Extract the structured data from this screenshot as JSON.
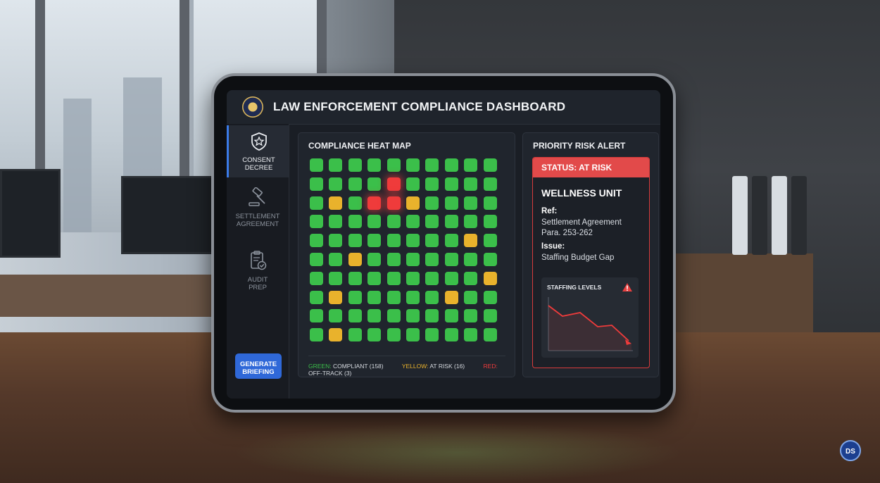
{
  "app": {
    "title": "LAW ENFORCEMENT COMPLIANCE DASHBOARD"
  },
  "sidebar": {
    "items": [
      {
        "label_line1": "CONSENT",
        "label_line2": "DECREE",
        "icon": "shield-star-icon",
        "active": true
      },
      {
        "label_line1": "SETTLEMENT",
        "label_line2": "AGREEMENT",
        "icon": "gavel-icon",
        "active": false
      },
      {
        "label_line1": "AUDIT",
        "label_line2": "PREP",
        "icon": "clipboard-check-icon",
        "active": false
      }
    ],
    "generate_line1": "GENERATE",
    "generate_line2": "BRIEFING"
  },
  "heatmap": {
    "title": "COMPLIANCE HEAT MAP",
    "rows": [
      "GGGGGGGGGG",
      "GGGGRGGGGG",
      "GYGRRYGGGG",
      "GGGGGGGGGG",
      "GGGGGGGGYG",
      "GGYGGGGGGG",
      "GGGGGGGGGY",
      "GYGGGGGYGG",
      "GGGGGGGGGG",
      "GYGGGGGGGG"
    ],
    "colors": {
      "G": "#3bbf4a",
      "Y": "#e9b22c",
      "R": "#ef3b3b"
    },
    "legend": {
      "green_label": "GREEN:",
      "green_text": "COMPLIANT (158)",
      "yellow_label": "YELLOW:",
      "yellow_text": "AT RISK (16)",
      "red_label": "RED:",
      "red_text": "OFF-TRACK (3)"
    }
  },
  "alert": {
    "title": "PRIORITY RISK ALERT",
    "status": "STATUS: AT RISK",
    "unit": "WELLNESS UNIT",
    "ref_label": "Ref:",
    "ref_line1": "Settlement Agreement",
    "ref_line2": "Para. 253-262",
    "issue_label": "Issue:",
    "issue_value": "Staffing Budget Gap",
    "chart_title": "STAFFING LEVELS"
  },
  "badge": {
    "text": "DS"
  }
}
